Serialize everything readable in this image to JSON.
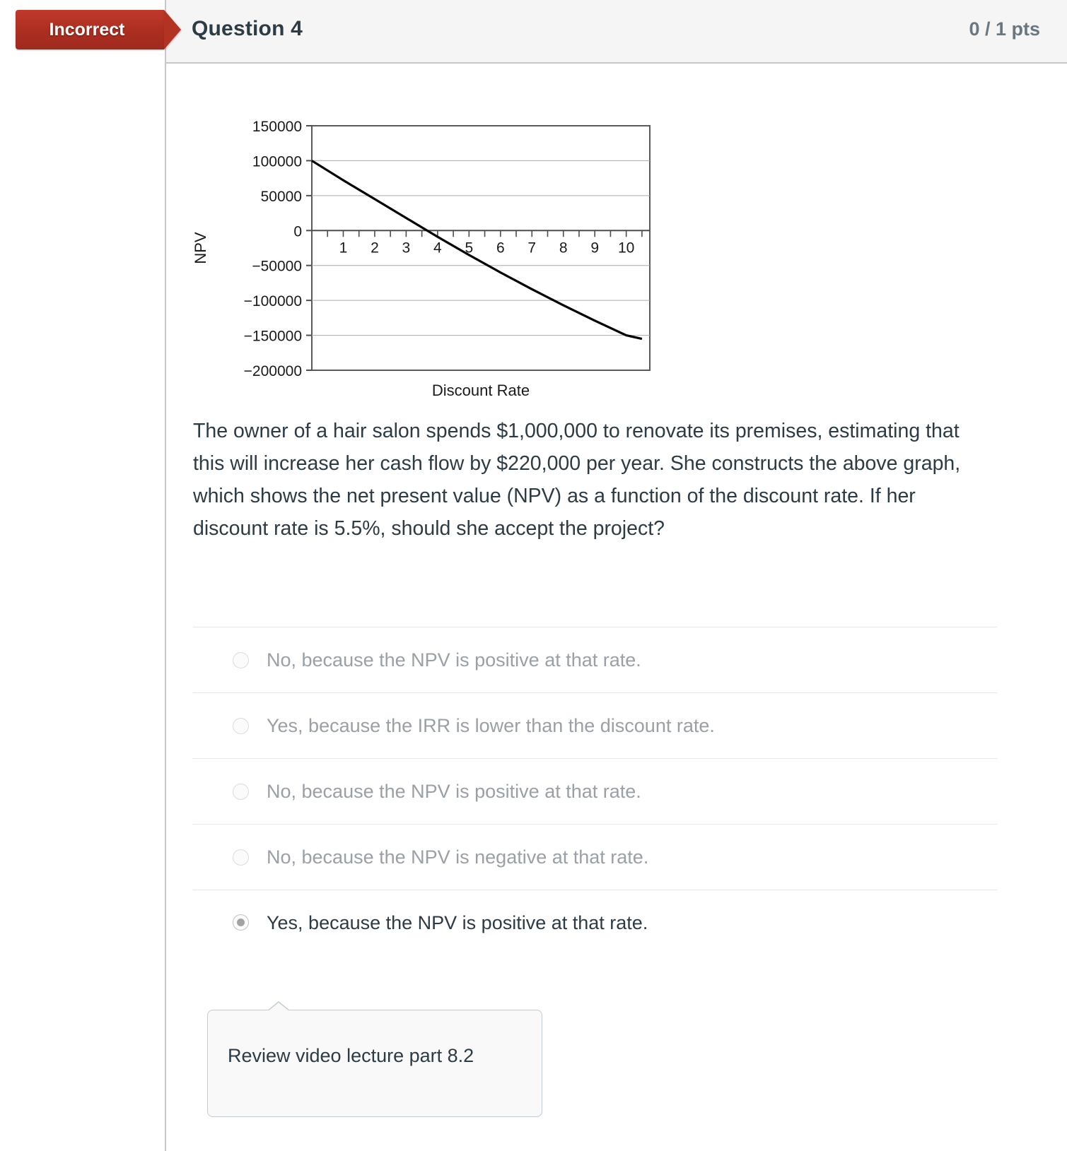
{
  "header": {
    "status_badge": "Incorrect",
    "title": "Question 4",
    "points": "0 / 1 pts"
  },
  "question": {
    "text": "The owner of a hair salon spends $1,000,000 to renovate its premises, estimating that this will increase her cash flow by $220,000 per year. She constructs the above graph, which shows the net present value (NPV) as a function of the discount rate. If her discount rate is 5.5%, should she accept the project?"
  },
  "answers": [
    {
      "label": "No, because the NPV is positive at that rate.",
      "selected": false
    },
    {
      "label": "Yes, because the IRR is lower than the discount rate.",
      "selected": false
    },
    {
      "label": "No, because the NPV is positive at that rate.",
      "selected": false
    },
    {
      "label": "No, because the NPV is negative at that rate.",
      "selected": false
    },
    {
      "label": "Yes, because the NPV is positive at that rate.",
      "selected": true
    }
  ],
  "comment": {
    "text": "Review video lecture part 8.2"
  },
  "colors": {
    "incorrect_red": "#b33323",
    "header_bg": "#f5f5f5",
    "text_dark": "#2d3b45",
    "text_muted": "#9aa0a6",
    "rule": "#e6e6e6",
    "callout_border": "#c2ccd2"
  },
  "chart_data": {
    "type": "line",
    "title": "",
    "xlabel": "Discount Rate",
    "ylabel": "NPV",
    "xlim": [
      0,
      10.75
    ],
    "ylim": [
      -200000,
      150000
    ],
    "xticks": [
      1,
      2,
      3,
      4,
      5,
      6,
      7,
      8,
      9,
      10
    ],
    "xtick_labels": [
      "1",
      "2",
      "3",
      "4",
      "5",
      "6",
      "7",
      "8",
      "9",
      "10"
    ],
    "minor_xticks": [
      0.5,
      1.5,
      2.5,
      3.5,
      4.5,
      5.5,
      6.5,
      7.5,
      8.5,
      9.5,
      10.5
    ],
    "yticks": [
      -200000,
      -150000,
      -100000,
      -50000,
      0,
      50000,
      100000,
      150000
    ],
    "ytick_labels": [
      "−200000",
      "−150000",
      "−100000",
      "−50000",
      "0",
      "50000",
      "100000",
      "150000"
    ],
    "grid": true,
    "legend": "none",
    "series": [
      {
        "name": "NPV",
        "x": [
          0,
          1,
          2,
          3,
          4,
          5,
          6,
          7,
          8,
          9,
          10,
          10.5
        ],
        "y": [
          100000,
          72000,
          45000,
          18000,
          -9000,
          -35000,
          -60000,
          -84000,
          -107000,
          -129000,
          -150000,
          -155000
        ]
      }
    ]
  }
}
